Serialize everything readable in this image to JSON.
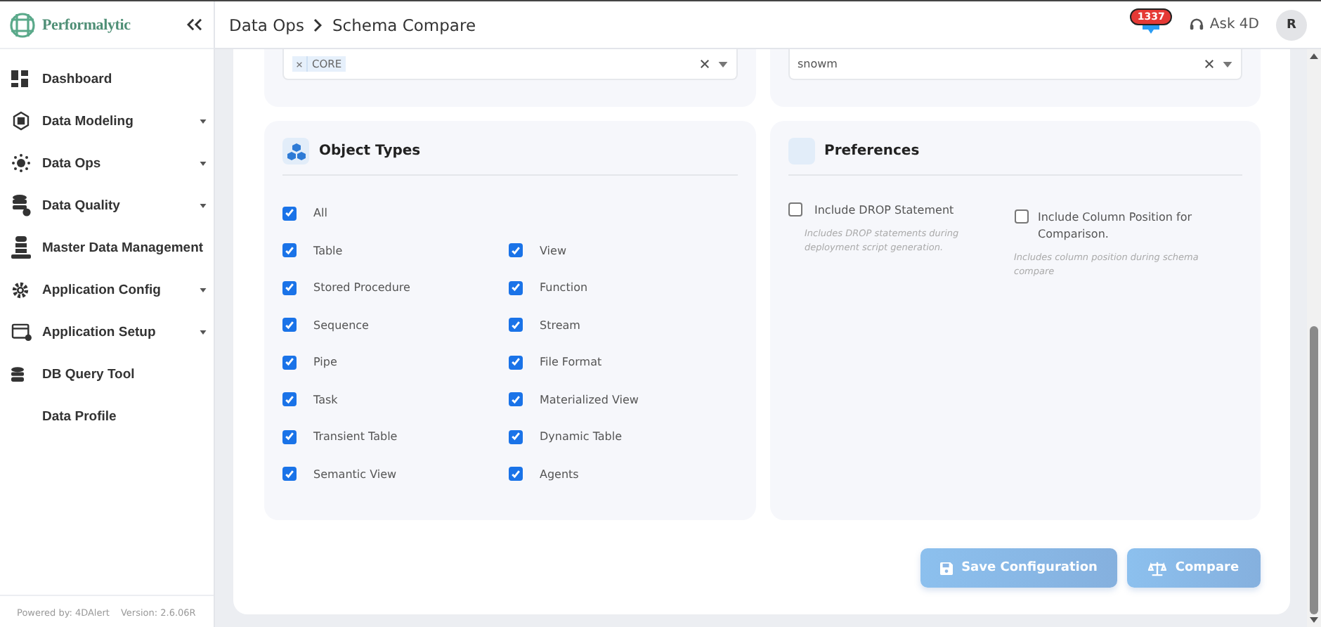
{
  "sidebar": {
    "brand": "Performalytic",
    "items": [
      {
        "label": "Dashboard",
        "submenu": false
      },
      {
        "label": "Data Modeling",
        "submenu": true
      },
      {
        "label": "Data Ops",
        "submenu": true
      },
      {
        "label": "Data Quality",
        "submenu": true
      },
      {
        "label": "Master Data Management",
        "submenu": false
      },
      {
        "label": "Application Config",
        "submenu": true
      },
      {
        "label": "Application Setup",
        "submenu": true
      },
      {
        "label": "DB Query Tool",
        "submenu": false
      },
      {
        "label": "Data Profile",
        "submenu": false
      }
    ],
    "footer": [
      "Powered by: 4DAlert",
      "Version: 2.6.06R"
    ]
  },
  "header": {
    "breadcrumb": [
      "Data Ops",
      "Schema Compare"
    ],
    "notification_count": "1337",
    "ask_label": "Ask 4D",
    "avatar": "R"
  },
  "filters": [
    {
      "kind": "tags",
      "tags": [
        "CORE"
      ]
    },
    {
      "kind": "text",
      "value": "snowm"
    }
  ],
  "object_types": {
    "title": "Object Types",
    "all": {
      "label": "All",
      "checked": true
    },
    "items": [
      {
        "label": "Table",
        "checked": true
      },
      {
        "label": "View",
        "checked": true
      },
      {
        "label": "Stored Procedure",
        "checked": true
      },
      {
        "label": "Function",
        "checked": true
      },
      {
        "label": "Sequence",
        "checked": true
      },
      {
        "label": "Stream",
        "checked": true
      },
      {
        "label": "Pipe",
        "checked": true
      },
      {
        "label": "File Format",
        "checked": true
      },
      {
        "label": "Task",
        "checked": true
      },
      {
        "label": "Materialized View",
        "checked": true
      },
      {
        "label": "Transient Table",
        "checked": true
      },
      {
        "label": "Dynamic Table",
        "checked": true
      },
      {
        "label": "Semantic View",
        "checked": true
      },
      {
        "label": "Agents",
        "checked": true
      }
    ]
  },
  "preferences": {
    "title": "Preferences",
    "options": [
      {
        "label": "Include DROP Statement",
        "description": "Includes DROP statements during deployment script generation.",
        "checked": false
      },
      {
        "label": "Include Column Position for Comparison.",
        "description": "Includes column position during schema compare",
        "checked": false
      }
    ]
  },
  "buttons": [
    {
      "label": "Save Configuration",
      "kind": "save"
    },
    {
      "label": "Compare",
      "kind": "compare"
    }
  ]
}
